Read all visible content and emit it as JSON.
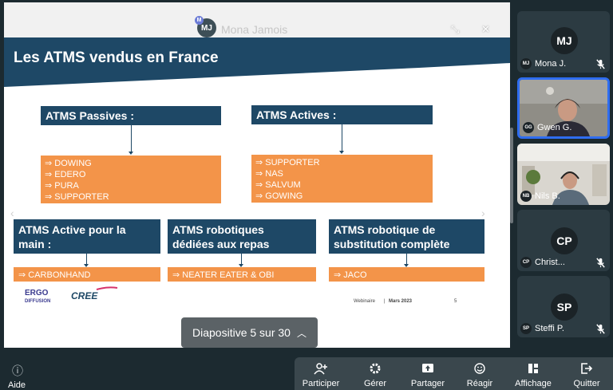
{
  "presenter": {
    "initials": "MJ",
    "badge": "M",
    "name": "Mona Jamois"
  },
  "slide": {
    "title": "Les ATMS vendus en France",
    "passives": {
      "header": "ATMS Passives :",
      "items": [
        "⇒ DOWING",
        "⇒ EDERO",
        "⇒ PURA",
        "⇒ SUPPORTER"
      ]
    },
    "actives": {
      "header": "ATMS Actives :",
      "items": [
        "⇒ SUPPORTER",
        "⇒ NAS",
        "⇒ SALVUM",
        "⇒ GOWING"
      ]
    },
    "main": {
      "header_line1": "ATMS Active pour la",
      "header_line2": "main :",
      "item": "⇒ CARBONHAND"
    },
    "repas": {
      "header_line1": "ATMS robotiques",
      "header_line2": "dédiées aux repas",
      "item": "⇒ NEATER EATER & OBI"
    },
    "substitution": {
      "header_line1": "ATMS robotique de",
      "header_line2": "substitution complète",
      "item": "⇒ JACO"
    },
    "logo_ergo": {
      "text1": "ERGO",
      "text2": "DIFFUSION"
    },
    "logo_cree": {
      "text": "CREE"
    },
    "footer": {
      "left": "Webinaire",
      "sep": "|",
      "date": "Mars 2023",
      "page": "5"
    },
    "colors": {
      "navy": "#1e4866",
      "orange": "#f39449"
    }
  },
  "slide_counter": {
    "label": "Diapositive 5 sur 30",
    "icon": "chevron-up-icon"
  },
  "participants": [
    {
      "initials": "MJ",
      "badge": "MJ",
      "name": "Mona J.",
      "muted": true
    },
    {
      "initials": "GG",
      "badge": "GG",
      "name": "Gwen G.",
      "muted": false,
      "video": true,
      "active": true
    },
    {
      "initials": "NB",
      "badge": "NB",
      "name": "Nils B.",
      "muted": false,
      "video": true
    },
    {
      "initials": "CP",
      "badge": "CP",
      "name": "Christ...",
      "muted": true
    },
    {
      "initials": "SP",
      "badge": "SP",
      "name": "Steffi P.",
      "muted": true
    }
  ],
  "toolbar": {
    "help": "Aide",
    "participate": "Participer",
    "manage": "Gérer",
    "share": "Partager",
    "react": "Réagir",
    "display": "Affichage",
    "quit": "Quitter"
  }
}
